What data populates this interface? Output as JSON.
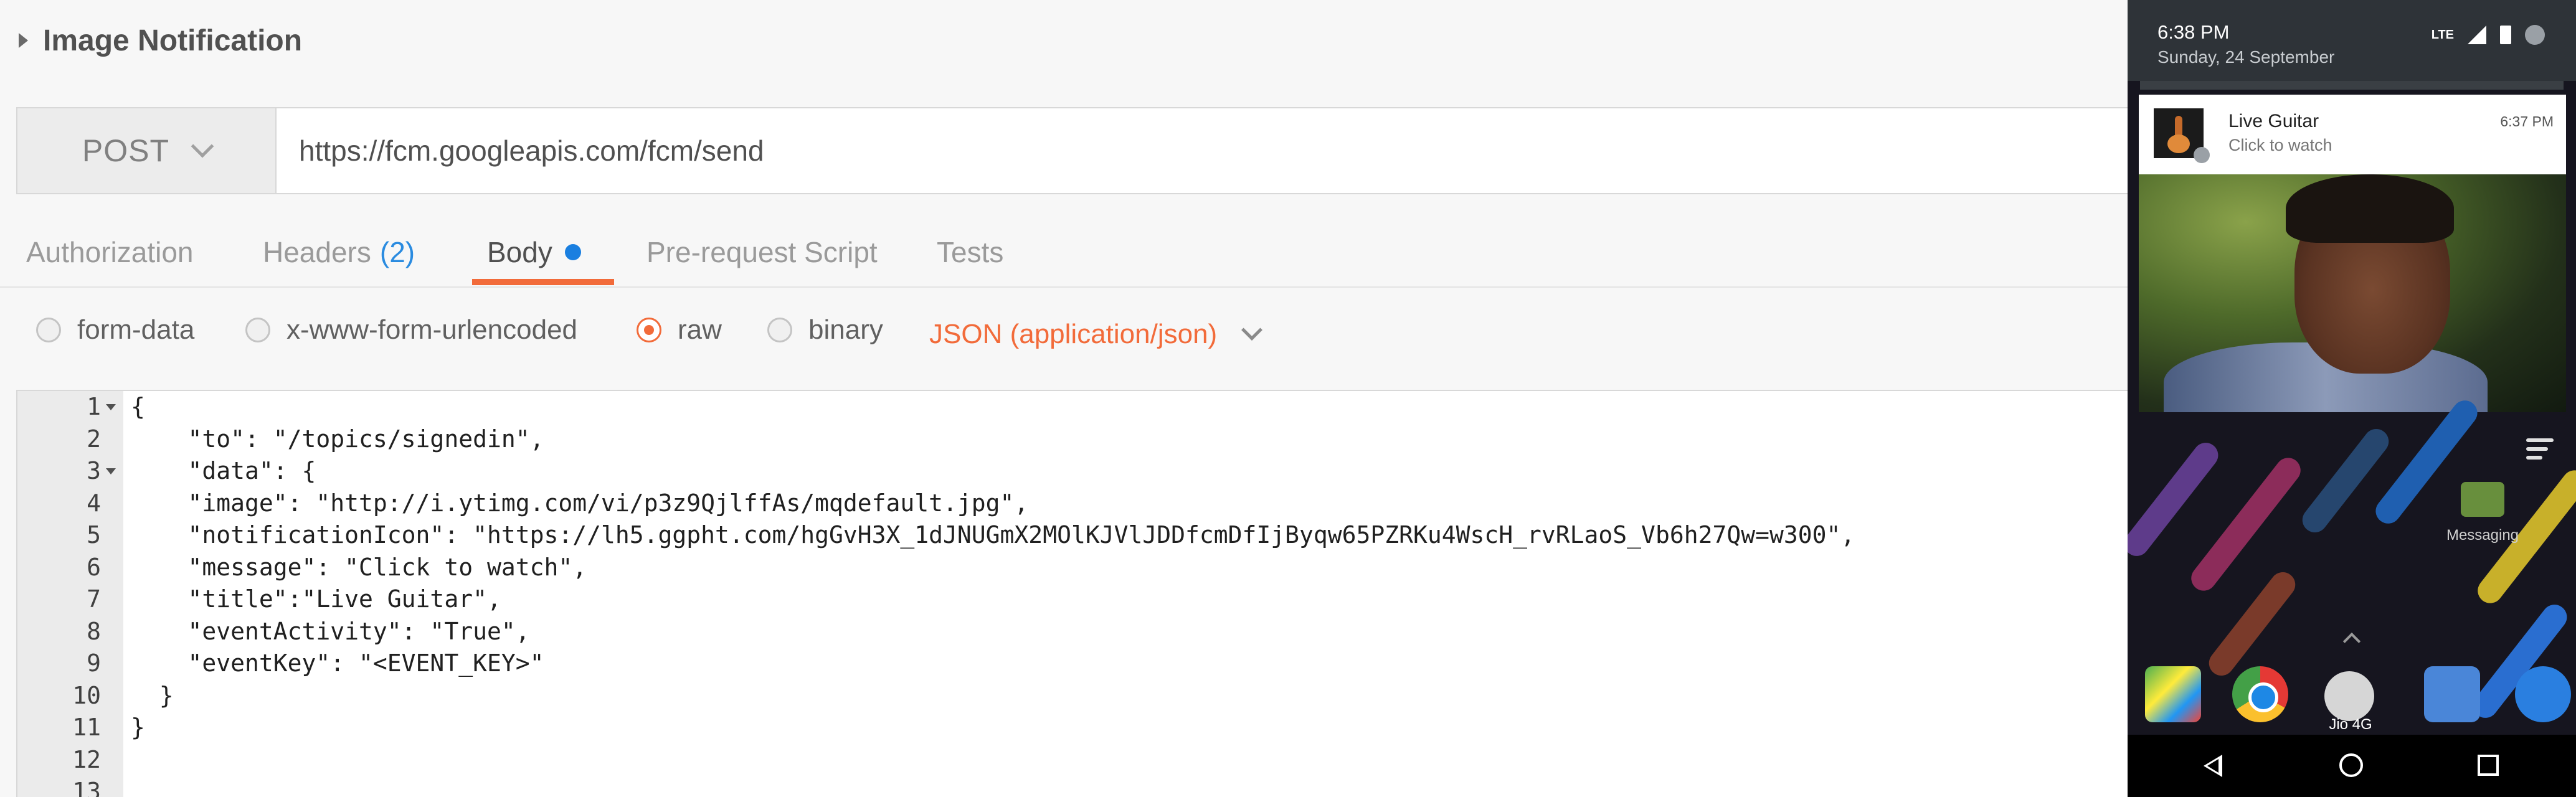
{
  "postman": {
    "request_name": "Image Notification",
    "method": "POST",
    "url": "https://fcm.googleapis.com/fcm/send",
    "tabs": [
      {
        "label": "Authorization",
        "count": ""
      },
      {
        "label": "Headers",
        "count": "(2)"
      },
      {
        "label": "Body",
        "count": ""
      },
      {
        "label": "Pre-request Script",
        "count": ""
      },
      {
        "label": "Tests",
        "count": ""
      }
    ],
    "active_tab": "Body",
    "body_modes": [
      "form-data",
      "x-www-form-urlencoded",
      "raw",
      "binary"
    ],
    "selected_mode": "raw",
    "content_type": "JSON (application/json)",
    "code_lines": [
      "{",
      "    \"to\": \"/topics/signedin\",",
      "    \"data\": {",
      "    \"image\": \"http://i.ytimg.com/vi/p3z9QjlffAs/mqdefault.jpg\",",
      "    \"notificationIcon\": \"https://lh5.ggpht.com/hgGvH3X_1dJNUGmX2MOlKJVlJDDfcmDfIjByqw65PZRKu4WscH_rvRLaoS_Vb6h27Qw=w300\",",
      "    \"message\": \"Click to watch\",",
      "    \"title\":\"Live Guitar\",",
      "    \"eventActivity\": \"True\",",
      "    \"eventKey\": \"<EVENT_KEY>\"",
      "  }",
      "}",
      "",
      ""
    ],
    "line_numbers": [
      "1",
      "2",
      "3",
      "4",
      "5",
      "6",
      "7",
      "8",
      "9",
      "10",
      "11",
      "12",
      "13"
    ]
  },
  "phone": {
    "time": "6:38 PM",
    "date": "Sunday, 24 September",
    "network": "LTE",
    "notification": {
      "title": "Live Guitar",
      "message": "Click to watch",
      "time": "6:37 PM"
    },
    "home_app_label": "Messaging",
    "carrier": "Jio 4G",
    "colors": {
      "accent": "#f26b3a",
      "link_blue": "#2a8be0"
    }
  }
}
